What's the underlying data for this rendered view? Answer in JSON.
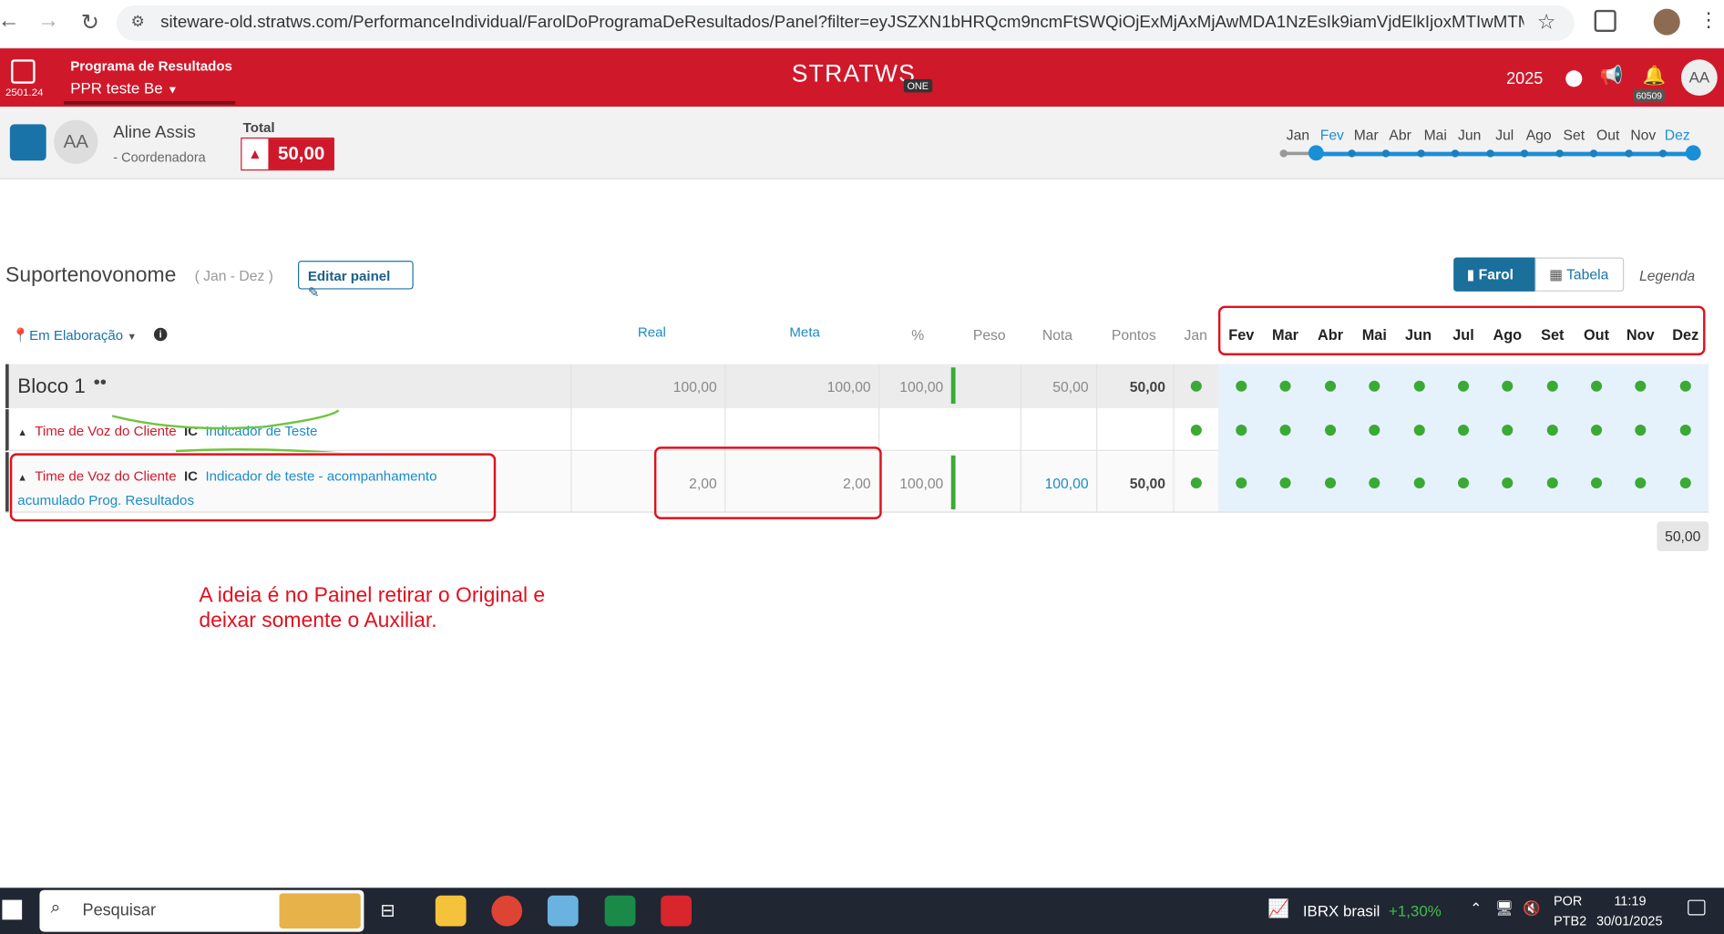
{
  "browser": {
    "url": "siteware-old.stratws.com/PerformanceIndividual/FarolDoProgramaDeResultados/Panel?filter=eyJSZXN1bHRQcm9ncmFtSWQiOjExMjAxMjAwMDA1NzEsIk9iamVjdElkIjoxMTIwMTMwMDI2OTQy..."
  },
  "header": {
    "version": "2501.24",
    "program_label": "Programa de Resultados",
    "program_name": "PPR teste Be",
    "logo": "STRATWS",
    "logo_sub": "ONE",
    "year": "2025",
    "notif_count": "60509",
    "user_initials": "AA"
  },
  "profile": {
    "initials": "AA",
    "name": "Aline Assis",
    "role": "-  Coordenadora",
    "total_label": "Total",
    "total_value": "50,00",
    "months": [
      "Jan",
      "Fev",
      "Mar",
      "Abr",
      "Mai",
      "Jun",
      "Jul",
      "Ago",
      "Set",
      "Out",
      "Nov",
      "Dez"
    ]
  },
  "panel": {
    "title": "Suportenovonome",
    "period": "( Jan - Dez )",
    "edit_button": "Editar painel",
    "farol": "Farol",
    "tabela": "Tabela",
    "legenda": "Legenda",
    "status": "Em Elaboração"
  },
  "table": {
    "headers": {
      "real": "Real",
      "meta": "Meta",
      "pct": "%",
      "peso": "Peso",
      "nota": "Nota",
      "pontos": "Pontos"
    },
    "months": [
      "Jan",
      "Fev",
      "Mar",
      "Abr",
      "Mai",
      "Jun",
      "Jul",
      "Ago",
      "Set",
      "Out",
      "Nov",
      "Dez"
    ],
    "block": {
      "name": "Bloco 1",
      "dots": "••",
      "real": "100,00",
      "meta": "100,00",
      "pct": "100,00",
      "nota": "50,00",
      "pontos": "50,00"
    },
    "row1": {
      "team": "Time de Voz do Cliente",
      "tag": "IC",
      "indicator": "Indicador de Teste"
    },
    "row2": {
      "team": "Time de Voz do Cliente",
      "tag": "IC",
      "indicator": "Indicador de teste - acompanhamento",
      "indicator_cont": "acumulado Prog. Resultados",
      "real": "2,00",
      "meta": "2,00",
      "pct": "100,00",
      "nota": "100,00",
      "pontos": "50,00"
    },
    "total": "50,00"
  },
  "annotation": {
    "line1": "A ideia é no Painel retirar o Original e",
    "line2": "deixar somente o Auxiliar."
  },
  "taskbar": {
    "search": "Pesquisar",
    "stock_name": "IBRX brasil",
    "stock_change": "+1,30%",
    "lang1": "POR",
    "lang2": "PTB2",
    "time": "11:19",
    "date": "30/01/2025"
  }
}
